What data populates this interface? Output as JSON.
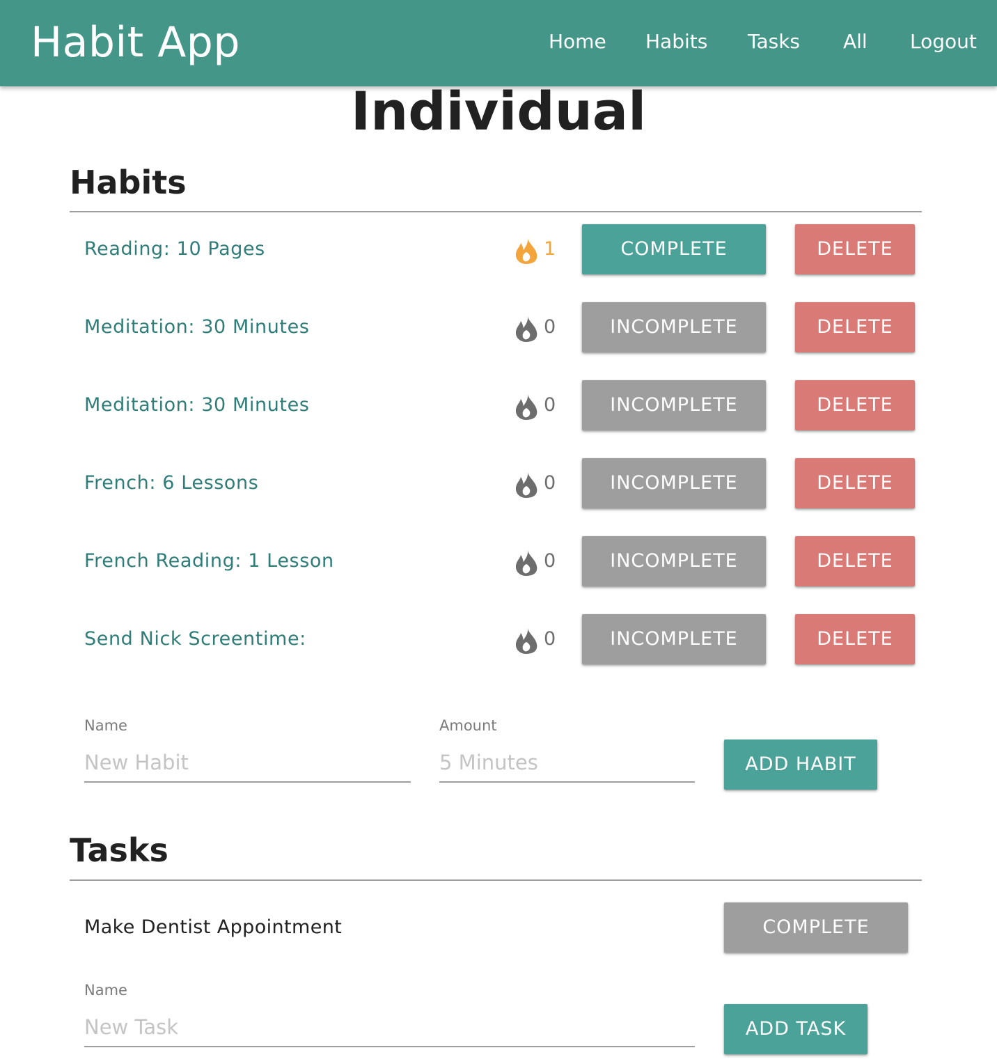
{
  "app": {
    "brand": "Habit App",
    "accent_color": "#439688"
  },
  "nav": {
    "items": [
      {
        "label": "Home"
      },
      {
        "label": "Habits"
      },
      {
        "label": "Tasks"
      },
      {
        "label": "All"
      },
      {
        "label": "Logout"
      }
    ]
  },
  "page": {
    "title": "Individual"
  },
  "habits": {
    "title": "Habits",
    "items": [
      {
        "name": "Reading: 10 Pages",
        "streak": "1",
        "streak_icon": "flame-icon",
        "streak_active": true,
        "status_label": "COMPLETE",
        "status_color": "#4ba298",
        "delete_label": "DELETE"
      },
      {
        "name": "Meditation: 30 Minutes",
        "streak": "0",
        "streak_icon": "flame-icon",
        "streak_active": false,
        "status_label": "INCOMPLETE",
        "status_color": "#9e9e9e",
        "delete_label": "DELETE"
      },
      {
        "name": "Meditation: 30 Minutes",
        "streak": "0",
        "streak_icon": "flame-icon",
        "streak_active": false,
        "status_label": "INCOMPLETE",
        "status_color": "#9e9e9e",
        "delete_label": "DELETE"
      },
      {
        "name": "French: 6 Lessons",
        "streak": "0",
        "streak_icon": "flame-icon",
        "streak_active": false,
        "status_label": "INCOMPLETE",
        "status_color": "#9e9e9e",
        "delete_label": "DELETE"
      },
      {
        "name": "French Reading: 1 Lesson",
        "streak": "0",
        "streak_icon": "flame-icon",
        "streak_active": false,
        "status_label": "INCOMPLETE",
        "status_color": "#9e9e9e",
        "delete_label": "DELETE"
      },
      {
        "name": "Send Nick Screentime:",
        "streak": "0",
        "streak_icon": "flame-icon",
        "streak_active": false,
        "status_label": "INCOMPLETE",
        "status_color": "#9e9e9e",
        "delete_label": "DELETE"
      }
    ],
    "form": {
      "name_label": "Name",
      "name_value": "",
      "name_placeholder": "New Habit",
      "amount_label": "Amount",
      "amount_value": "",
      "amount_placeholder": "5 Minutes",
      "submit_label": "ADD HABIT"
    }
  },
  "tasks": {
    "title": "Tasks",
    "items": [
      {
        "name": "Make Dentist Appointment",
        "status_label": "COMPLETE",
        "status_color": "#9e9e9e"
      }
    ],
    "form": {
      "name_label": "Name",
      "name_value": "",
      "name_placeholder": "New Task",
      "submit_label": "ADD TASK"
    }
  },
  "colors": {
    "teal_button": "#4ba298",
    "grey_button": "#9e9e9e",
    "red_button": "#d97a77",
    "habit_text": "#2f7d78",
    "streak_active": "#f3a53b",
    "streak_inactive": "#6d6d6d"
  }
}
